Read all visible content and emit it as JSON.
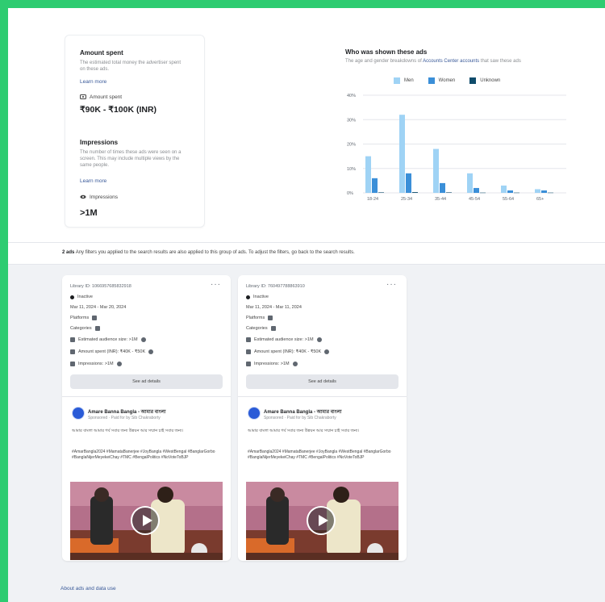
{
  "spend": {
    "title": "Amount spent",
    "description": "The estimated total money the advertiser spent on these ads.",
    "learn_more": "Learn more",
    "icon_label": "Amount spent",
    "value": "₹90K - ₹100K (INR)"
  },
  "impressions": {
    "title": "Impressions",
    "description": "The number of times these ads were seen on a screen. This may include multiple views by the same people.",
    "learn_more": "Learn more",
    "icon_label": "Impressions",
    "value": ">1M"
  },
  "chart_data": {
    "type": "bar",
    "title": "Who was shown these ads",
    "subtitle_prefix": "The age and gender breakdowns of",
    "subtitle_link": "Accounts Center accounts",
    "subtitle_suffix": "that saw these ads",
    "categories": [
      "18-24",
      "25-34",
      "35-44",
      "45-54",
      "55-64",
      "65+"
    ],
    "series": [
      {
        "name": "Men",
        "color": "#9fd3f5",
        "values": [
          15,
          32,
          18,
          8,
          3,
          1.5
        ]
      },
      {
        "name": "Women",
        "color": "#3b8fd8",
        "values": [
          6,
          8,
          4,
          2,
          1,
          1
        ]
      },
      {
        "name": "Unknown",
        "color": "#0f4c6b",
        "values": [
          0.2,
          0.3,
          0.2,
          0.1,
          0.1,
          0.1
        ]
      }
    ],
    "yticks": [
      "0%",
      "10%",
      "20%",
      "30%",
      "40%"
    ],
    "ylim": [
      0,
      40
    ],
    "legend": "top"
  },
  "results": {
    "count": "2 ads",
    "note": "Any filters you applied to the search results are also applied to this group of ads. To adjust the filters, go back to the search results."
  },
  "ads": [
    {
      "library_id": "Library ID: 1066957685832918",
      "status": "Inactive",
      "dates": "Mar 11, 2024 - Mar 20, 2024",
      "platforms_label": "Platforms",
      "categories_label": "Categories",
      "audience": "Estimated audience size: >1M",
      "spent": "Amount spent (INR): ₹40K - ₹50K",
      "impressions": "Impressions: >1M",
      "details_button": "See ad details",
      "advertiser": "Amare Banna Bangla - আমার বাংলা",
      "sponsored": "Sponsored · Paid for by Sib Chakraborty",
      "body1": "আমার বাংলা আমার গর্ব সবার জন্য উন্নয়ন আর সম্মান চাই সবার জন্য।",
      "body2": "#AmarBangla2024 #MamataBanerjee #JoyBangla #WestBengal #BanglarGorbo #BanglaNijerMeyekeiChay #TMC #BengalPolitics #NoVoteToBJP"
    },
    {
      "library_id": "Library ID: 760497788863910",
      "status": "Inactive",
      "dates": "Mar 11, 2024 - Mar 11, 2024",
      "platforms_label": "Platforms",
      "categories_label": "Categories",
      "audience": "Estimated audience size: >1M",
      "spent": "Amount spent (INR): ₹40K - ₹50K",
      "impressions": "Impressions: >1M",
      "details_button": "See ad details",
      "advertiser": "Amare Banna Bangla - আমার বাংলা",
      "sponsored": "Sponsored · Paid for by Sib Chakraborty",
      "body1": "আমার বাংলা আমার গর্ব সবার জন্য উন্নয়ন আর সম্মান চাই সবার জন্য।",
      "body2": "#AmarBangla2024 #MamataBanerjee #JoyBangla #WestBengal #BanglarGorbo #BanglaNijerMeyekeiChay #TMC #BengalPolitics #NoVoteToBJP"
    }
  ],
  "footer": {
    "link": "About ads and data use"
  },
  "colors": {
    "accent": "#2ecc71",
    "link": "#385898"
  }
}
